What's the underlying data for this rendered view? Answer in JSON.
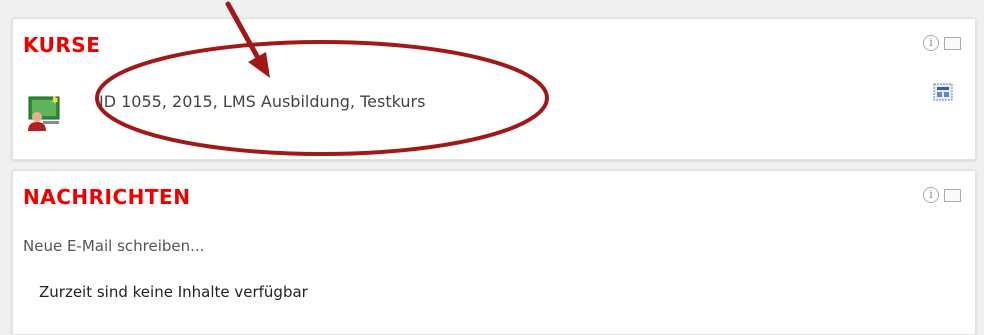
{
  "kurse": {
    "title": "KURSE",
    "course_entry": "ID 1055, 2015, LMS Ausbildung, Testkurs",
    "info_icon": "info-icon",
    "window_icon": "window-icon",
    "course_icon": "teacher-board-icon",
    "action_icon": "course-calendar-icon"
  },
  "nachrichten": {
    "title": "NACHRICHTEN",
    "compose_link": "Neue E-Mail schreiben...",
    "empty_message": "Zurzeit sind keine Inhalte verfügbar",
    "info_icon": "info-icon",
    "window_icon": "window-icon"
  },
  "colors": {
    "title_red": "#ee0000",
    "annotation_red": "#a01818"
  },
  "annotation": {
    "shapes": [
      "arrow",
      "ellipse"
    ]
  }
}
